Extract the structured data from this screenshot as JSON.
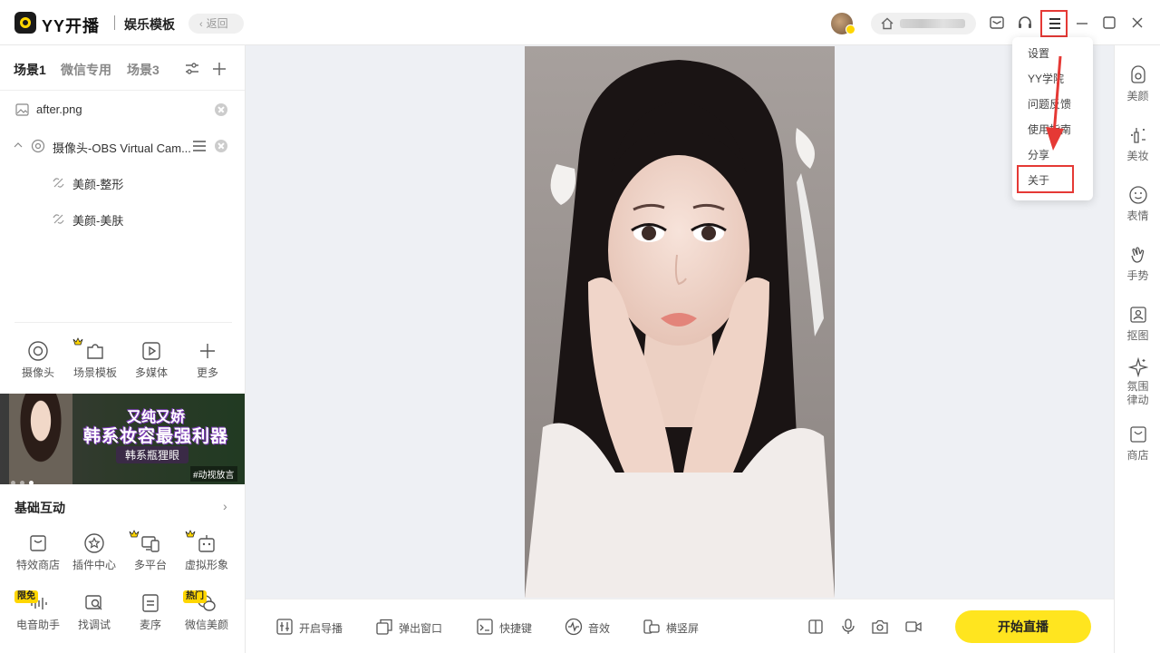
{
  "app": {
    "title": "YY开播",
    "section": "娱乐模板",
    "back_label": "返回"
  },
  "menu": {
    "items": [
      {
        "label": "设置"
      },
      {
        "label": "YY学院"
      },
      {
        "label": "问题反馈"
      },
      {
        "label": "使用指南"
      },
      {
        "label": "分享"
      },
      {
        "label": "关于"
      }
    ],
    "highlighted": "关于"
  },
  "scenes": {
    "tabs": [
      "场景1",
      "微信专用",
      "场景3"
    ],
    "active": "场景1"
  },
  "sources": [
    {
      "label": "after.png",
      "icon": "image-icon"
    },
    {
      "label": "摄像头-OBS Virtual Cam...",
      "icon": "camera-icon"
    },
    {
      "label": "美颜-整形",
      "icon": "beauty-link-icon"
    },
    {
      "label": "美颜-美肤",
      "icon": "beauty-link-icon"
    }
  ],
  "tools": [
    {
      "label": "摄像头",
      "icon": "camera-icon"
    },
    {
      "label": "场景模板",
      "icon": "puzzle-icon"
    },
    {
      "label": "多媒体",
      "icon": "play-icon"
    },
    {
      "label": "更多",
      "icon": "plus-icon"
    }
  ],
  "banner": {
    "line1": "又纯又娇",
    "line2": "韩系妆容最强利器",
    "line3": "韩系瓶狸眼",
    "tag": "#动视放言"
  },
  "interactions": {
    "title": "基础互动",
    "items": [
      {
        "label": "特效商店",
        "icon": "shop-bag-icon"
      },
      {
        "label": "插件中心",
        "icon": "star-circle-icon"
      },
      {
        "label": "多平台",
        "icon": "devices-icon"
      },
      {
        "label": "虚拟形象",
        "icon": "robot-icon"
      },
      {
        "label": "电音助手",
        "icon": "audio-wave-icon",
        "tag": "限免"
      },
      {
        "label": "找调试",
        "icon": "debug-icon"
      },
      {
        "label": "麦序",
        "icon": "list-icon"
      },
      {
        "label": "微信美颜",
        "icon": "wechat-icon",
        "tag": "热门"
      }
    ]
  },
  "bottom_bar": {
    "items": [
      {
        "label": "开启导播",
        "icon": "sliders-icon"
      },
      {
        "label": "弹出窗口",
        "icon": "popout-icon"
      },
      {
        "label": "快捷键",
        "icon": "keyboard-icon"
      },
      {
        "label": "音效",
        "icon": "sound-effect-icon"
      },
      {
        "label": "横竖屏",
        "icon": "rotate-icon"
      }
    ],
    "start_label": "开始直播"
  },
  "right_panel": {
    "items": [
      {
        "label": "美颜",
        "icon": "beauty-icon"
      },
      {
        "label": "美妆",
        "icon": "makeup-icon"
      },
      {
        "label": "表情",
        "icon": "smile-icon"
      },
      {
        "label": "手势",
        "icon": "hand-icon"
      },
      {
        "label": "抠图",
        "icon": "cutout-icon"
      },
      {
        "label": "氛围律动",
        "icon": "sparkle-icon"
      },
      {
        "label": "商店",
        "icon": "shop-icon"
      }
    ]
  },
  "colors": {
    "accent": "#ffe51f",
    "highlight": "#e53935",
    "canvas": "#eef0f4"
  }
}
